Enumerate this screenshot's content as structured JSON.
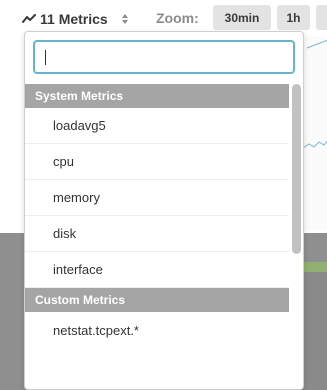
{
  "toolbar": {
    "metric_selector_label": "11 Metrics",
    "zoom_label": "Zoom:",
    "zoom_options": [
      "30min",
      "1h",
      ""
    ]
  },
  "dropdown": {
    "search": {
      "value": "",
      "placeholder": ""
    },
    "groups": [
      {
        "header": "System Metrics",
        "items": [
          "loadavg5",
          "cpu",
          "memory",
          "disk",
          "interface"
        ]
      },
      {
        "header": "Custom Metrics",
        "items": [
          "netstat.tcpext.*"
        ]
      }
    ]
  },
  "icons": {
    "metric_selector": "trend-line-icon",
    "selector_arrows": "up-down-arrows-icon"
  },
  "colors": {
    "search_focus_border": "#66b6ca",
    "group_header_bg": "#a5a5a5",
    "zoom_button_bg": "#e3e3e3"
  }
}
